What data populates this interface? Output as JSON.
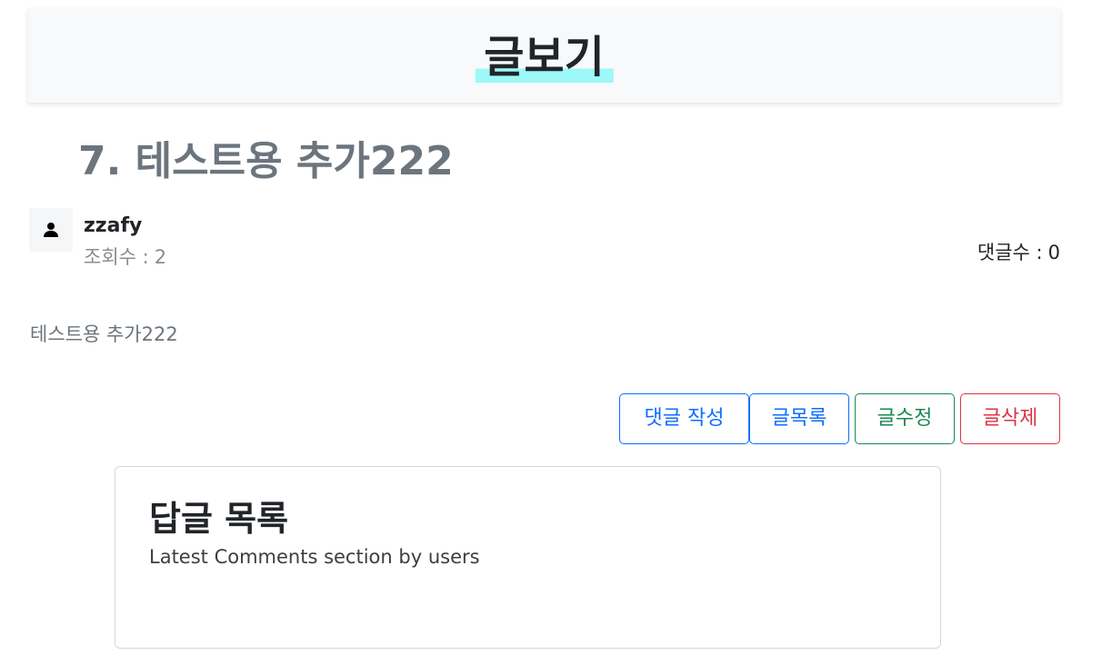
{
  "header": {
    "title": "글보기"
  },
  "post": {
    "title": "7. 테스트용 추가222",
    "author": "zzafy",
    "views_label": "조회수 :",
    "views_value": "2",
    "comment_count_label": "댓글수 :",
    "comment_count_value": "0",
    "content": "테스트용 추가222"
  },
  "actions": {
    "reply_label": "댓글 작성",
    "list_label": "글목록",
    "edit_label": "글수정",
    "delete_label": "글삭제"
  },
  "comments": {
    "title": "답글 목록",
    "subtitle": "Latest Comments section by users"
  },
  "icons": {
    "avatar": "person-icon"
  },
  "colors": {
    "highlight": "#9cf9f7",
    "primary": "#0d6efd",
    "success": "#198754",
    "danger": "#dc3545"
  }
}
